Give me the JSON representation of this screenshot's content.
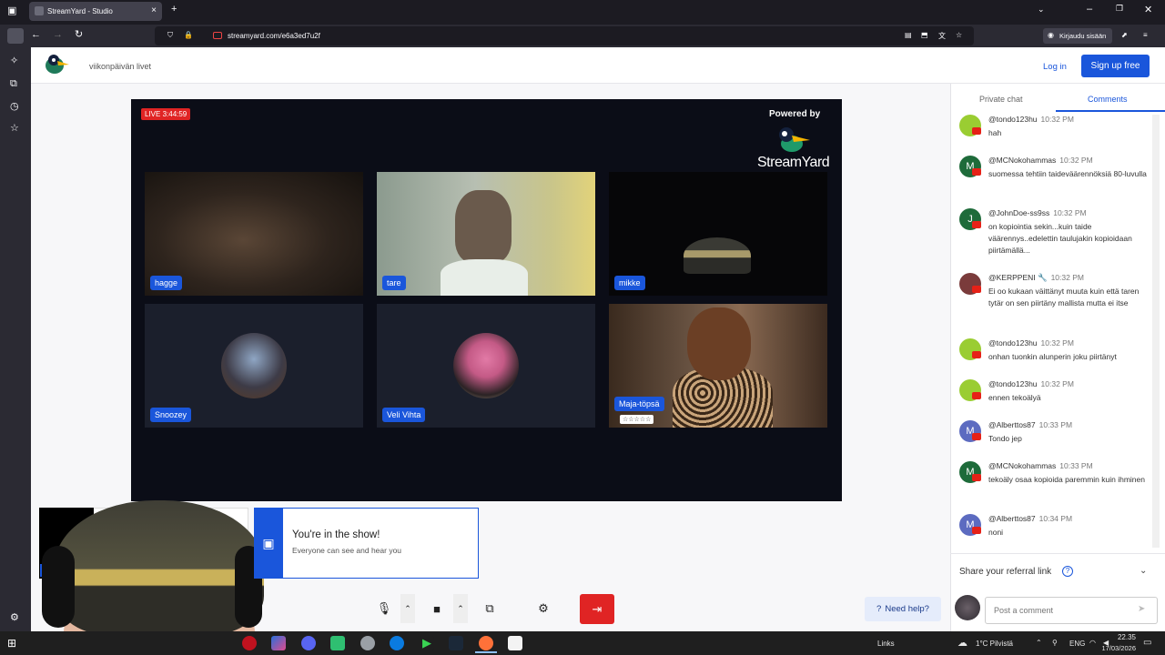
{
  "browser": {
    "tab_title": "StreamYard - Studio",
    "tab_close": "×",
    "new_tab": "+",
    "url": "streamyard.com/e6a3ed7u2f",
    "signin_label": "Kirjaudu sisään"
  },
  "header": {
    "studio_title": "viikonpäivän livet",
    "login_label": "Log in",
    "signup_label": "Sign up free"
  },
  "stage": {
    "live_badge": "LIVE 3:44:59",
    "powered_by": "Powered by",
    "brand": "StreamYard",
    "participants": [
      {
        "name": "hagge"
      },
      {
        "name": "tare"
      },
      {
        "name": "mikke"
      },
      {
        "name": "Snoozey"
      },
      {
        "name": "Veli Vihta"
      },
      {
        "name": "Maja-töpsä",
        "stars": "☆☆☆☆☆"
      }
    ]
  },
  "notification": {
    "title": "You're in the show!",
    "subtitle": "Everyone can see and hear you"
  },
  "controls": {
    "help_label": "Need help?"
  },
  "panel": {
    "tab_private": "Private chat",
    "tab_comments": "Comments",
    "comments": [
      {
        "avatar": "",
        "avatar_color": "#9acd32",
        "user": "@tondo123hu",
        "time": "10:32 PM",
        "text": "hah"
      },
      {
        "avatar": "M",
        "avatar_color": "#1e6b3a",
        "user": "@MCNokohammas",
        "time": "10:32 PM",
        "text": "suomessa tehtiin taideväärennöksiä 80-luvulla"
      },
      {
        "avatar": "J",
        "avatar_color": "#1e6b3a",
        "user": "@JohnDoe-ss9ss",
        "time": "10:32 PM",
        "text": "on kopiointia sekin...kuin taide väärennys..edelettin taulujakin kopioidaan piirtämällä..."
      },
      {
        "avatar": "",
        "avatar_color": "#7a3b3b",
        "user": "@KERPPENI 🔧",
        "time": "10:32 PM",
        "text": "Ei oo kukaan väittänyt muuta kuin että taren tytär on sen piirtäny mallista mutta ei itse"
      },
      {
        "avatar": "",
        "avatar_color": "#9acd32",
        "user": "@tondo123hu",
        "time": "10:32 PM",
        "text": "onhan tuonkin alunperin joku piirtänyt"
      },
      {
        "avatar": "",
        "avatar_color": "#9acd32",
        "user": "@tondo123hu",
        "time": "10:32 PM",
        "text": "ennen tekoälyä"
      },
      {
        "avatar": "M",
        "avatar_color": "#5c6bc0",
        "user": "@Alberttos87",
        "time": "10:33 PM",
        "text": "Tondo jep"
      },
      {
        "avatar": "M",
        "avatar_color": "#1e6b3a",
        "user": "@MCNokohammas",
        "time": "10:33 PM",
        "text": "tekoäly osaa kopioida paremmin kuin ihminen"
      },
      {
        "avatar": "M",
        "avatar_color": "#5c6bc0",
        "user": "@Alberttos87",
        "time": "10:34 PM",
        "text": "noni"
      }
    ],
    "referral_label": "Share your referral link",
    "comment_placeholder": "Post a comment"
  },
  "taskbar": {
    "links_label": "Links",
    "weather": "1°C Pilvistä",
    "lang": "ENG",
    "time": "22.35",
    "date": "17/03/2026"
  }
}
